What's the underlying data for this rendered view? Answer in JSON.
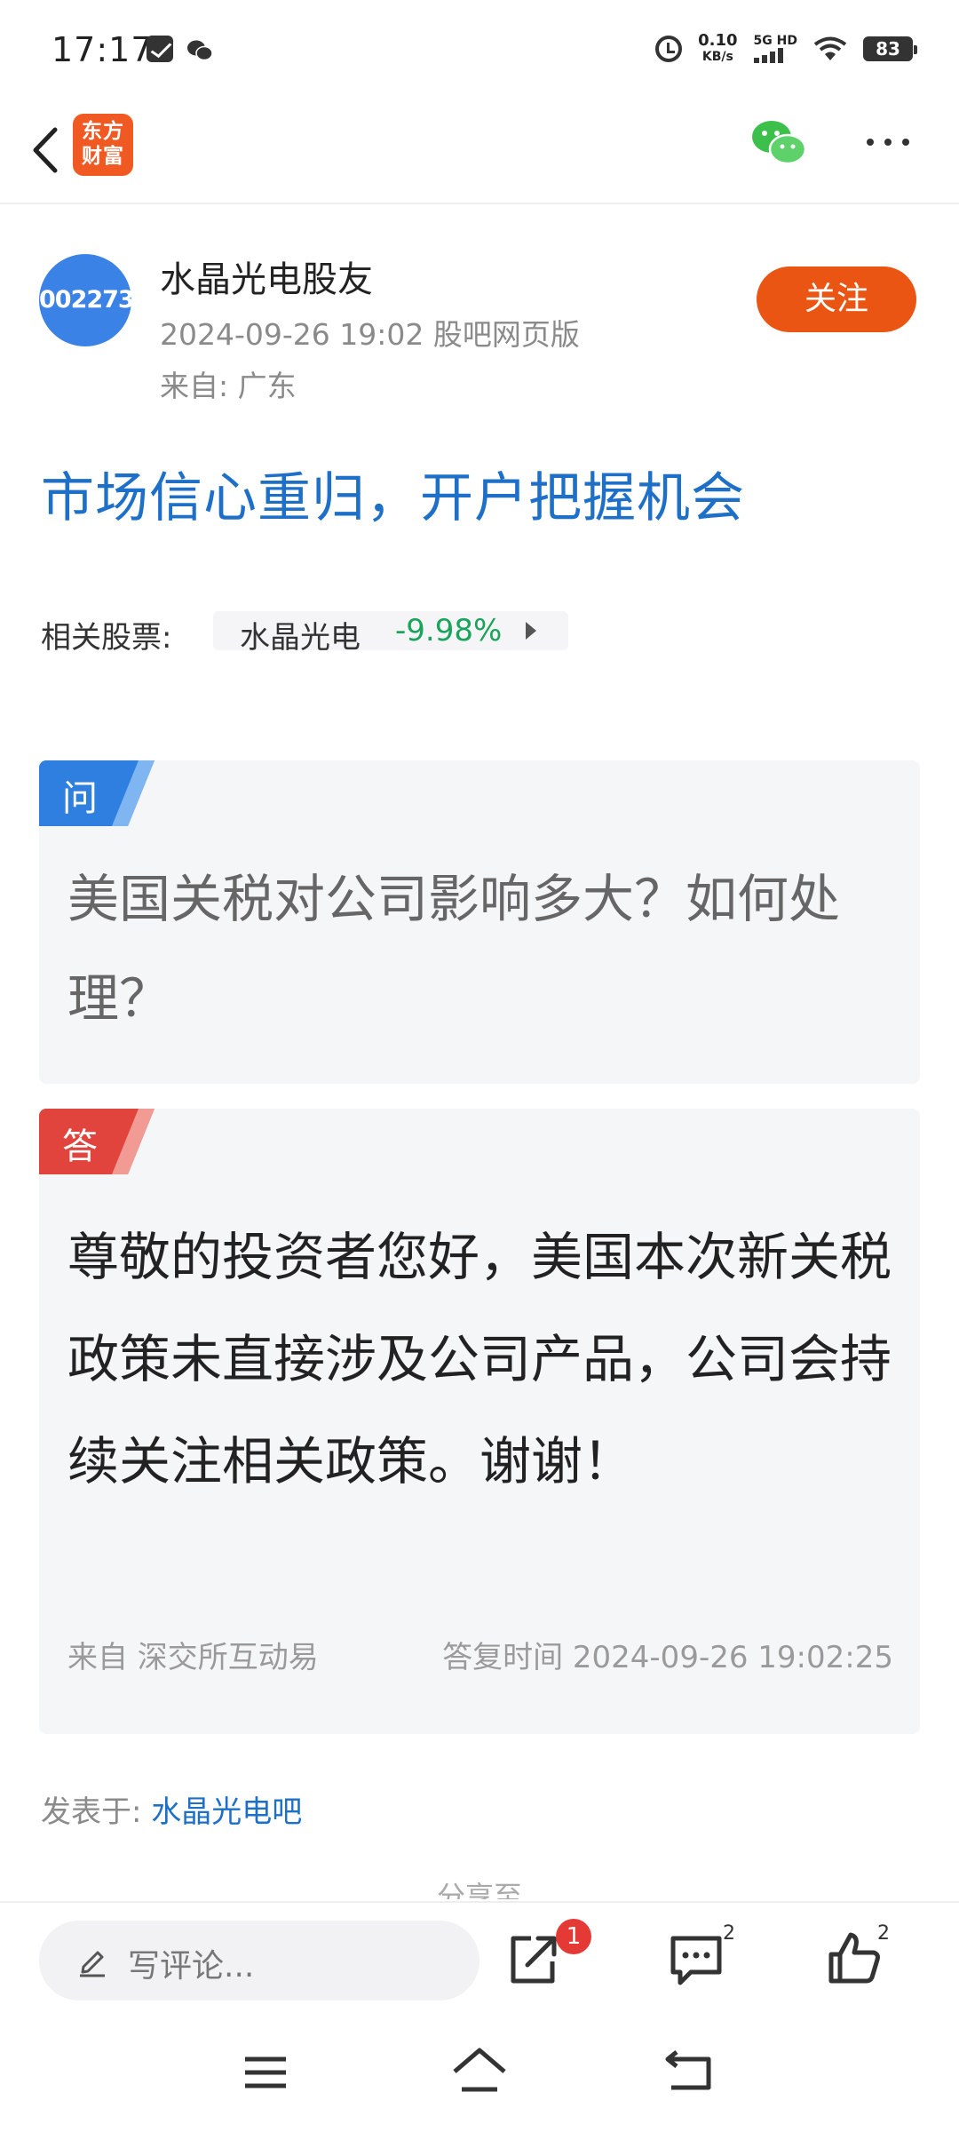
{
  "status_bar": {
    "time": "17:17",
    "net_speed_value": "0.10",
    "net_speed_unit": "KB/s",
    "network": "5G HD",
    "battery": "83"
  },
  "nav": {
    "logo_line1": "东方",
    "logo_line2": "财富"
  },
  "author": {
    "avatar_text": "002273",
    "name": "水晶光电股友",
    "meta": "2024-09-26 19:02 股吧网页版",
    "from": "来自: 广东",
    "follow_label": "关注"
  },
  "post": {
    "title": "市场信心重归，开户把握机会"
  },
  "related": {
    "label": "相关股票:",
    "stock_name": "水晶光电",
    "stock_change": "-9.98%"
  },
  "question": {
    "tag": "问",
    "text": "美国关税对公司影响多大？如何处理？"
  },
  "answer": {
    "tag": "答",
    "text": "尊敬的投资者您好，美国本次新关税政策未直接涉及公司产品，公司会持续关注相关政策。谢谢！",
    "source": "来自 深交所互动易",
    "time": "答复时间 2024-09-26 19:02:25"
  },
  "posted_in": {
    "label": "发表于: ",
    "bar_name": "水晶光电吧"
  },
  "share_to": "分享至",
  "action_bar": {
    "comment_placeholder": "写评论...",
    "share_badge": "1",
    "comment_count": "2",
    "like_count": "2"
  },
  "colors": {
    "accent_orange": "#ea5514",
    "title_blue": "#1e6fc8",
    "stock_down_green": "#1aa35a",
    "question_tag_blue": "#2f7fe0",
    "answer_tag_red": "#e0443c"
  }
}
